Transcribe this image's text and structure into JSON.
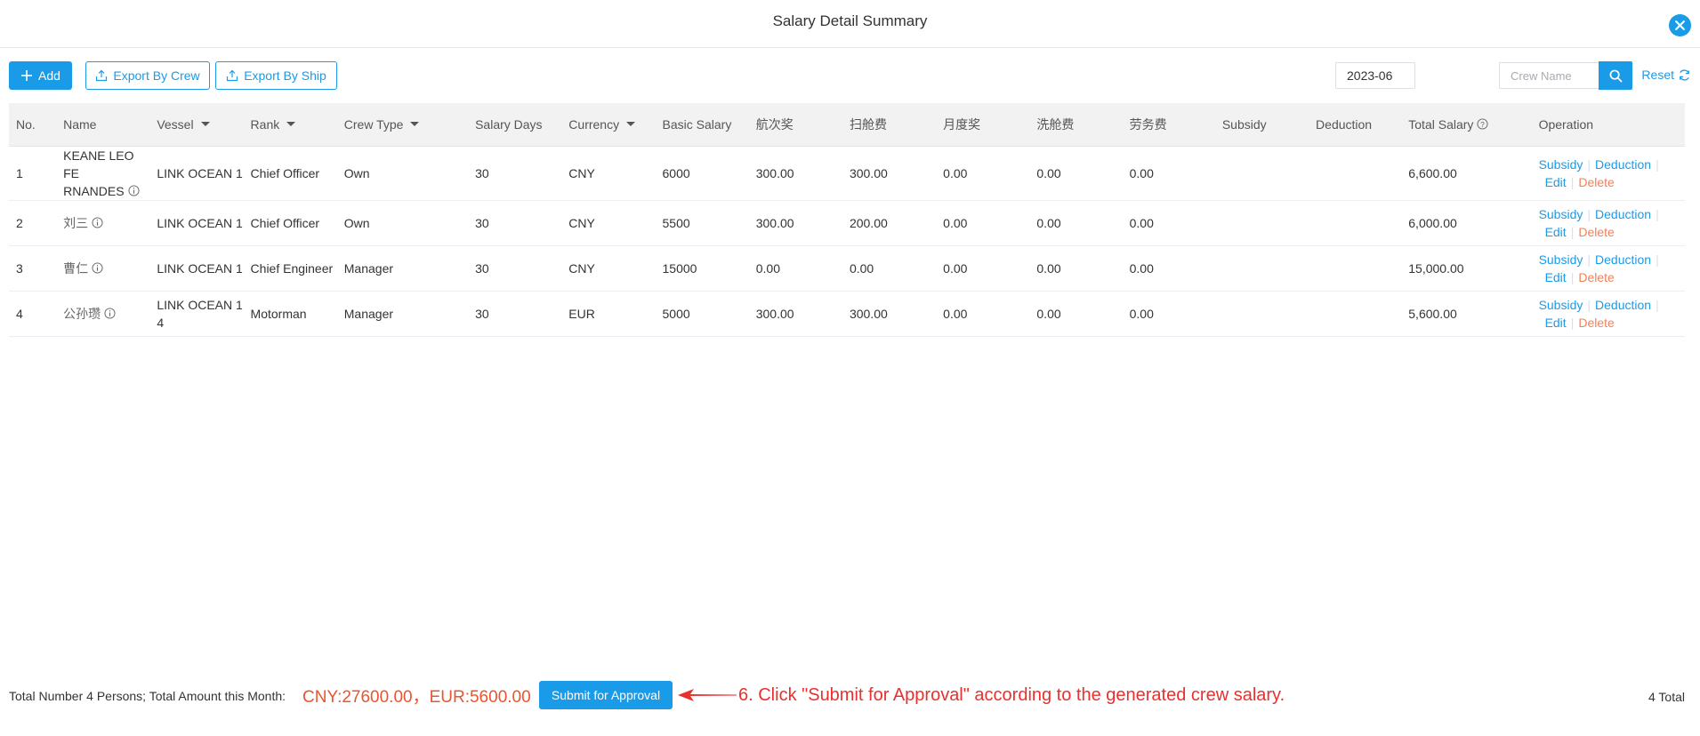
{
  "dialog": {
    "title": "Salary Detail Summary",
    "close_icon": "close-icon"
  },
  "toolbar": {
    "add_label": "Add",
    "export_crew_label": "Export By Crew",
    "export_ship_label": "Export By Ship"
  },
  "search": {
    "month_value": "2023-06",
    "name_placeholder": "Crew Name",
    "reset_label": "Reset"
  },
  "table": {
    "headers": {
      "no": "No.",
      "name": "Name",
      "vessel": "Vessel",
      "rank": "Rank",
      "crew_type": "Crew Type",
      "salary_days": "Salary Days",
      "currency": "Currency",
      "basic_salary": "Basic Salary",
      "voyage_bonus": "航次奖",
      "cabin_fee": "扫舱费",
      "monthly_bonus": "月度奖",
      "wash_fee": "洗舱费",
      "labor_fee": "劳务费",
      "subsidy": "Subsidy",
      "deduction": "Deduction",
      "total_salary": "Total Salary",
      "operation": "Operation"
    },
    "rows": [
      {
        "no": "1",
        "name_line1": "KEANE LEO FE",
        "name_line2": "RNANDES",
        "vessel_line1": "LINK OCEAN 1",
        "vessel_line2": "",
        "rank": "Chief Officer",
        "crew_type": "Own",
        "salary_days": "30",
        "currency": "CNY",
        "basic_salary": "6000",
        "voyage_bonus": "300.00",
        "cabin_fee": "300.00",
        "monthly_bonus": "0.00",
        "wash_fee": "0.00",
        "labor_fee": "0.00",
        "subsidy": "",
        "deduction": "",
        "total_salary": "6,600.00"
      },
      {
        "no": "2",
        "name_line1": "刘三",
        "name_line2": "",
        "vessel_line1": "LINK OCEAN 1",
        "vessel_line2": "",
        "rank": "Chief Officer",
        "crew_type": "Own",
        "salary_days": "30",
        "currency": "CNY",
        "basic_salary": "5500",
        "voyage_bonus": "300.00",
        "cabin_fee": "200.00",
        "monthly_bonus": "0.00",
        "wash_fee": "0.00",
        "labor_fee": "0.00",
        "subsidy": "",
        "deduction": "",
        "total_salary": "6,000.00"
      },
      {
        "no": "3",
        "name_line1": "曹仁",
        "name_line2": "",
        "vessel_line1": "LINK OCEAN 1",
        "vessel_line2": "",
        "rank": "Chief Engineer",
        "crew_type": "Manager",
        "salary_days": "30",
        "currency": "CNY",
        "basic_salary": "15000",
        "voyage_bonus": "0.00",
        "cabin_fee": "0.00",
        "monthly_bonus": "0.00",
        "wash_fee": "0.00",
        "labor_fee": "0.00",
        "subsidy": "",
        "deduction": "",
        "total_salary": "15,000.00"
      },
      {
        "no": "4",
        "name_line1": "公孙瓒",
        "name_line2": "",
        "vessel_line1": "LINK OCEAN 1",
        "vessel_line2": "4",
        "rank": "Motorman",
        "crew_type": "Manager",
        "salary_days": "30",
        "currency": "EUR",
        "basic_salary": "5000",
        "voyage_bonus": "300.00",
        "cabin_fee": "300.00",
        "monthly_bonus": "0.00",
        "wash_fee": "0.00",
        "labor_fee": "0.00",
        "subsidy": "",
        "deduction": "",
        "total_salary": "5,600.00"
      }
    ],
    "ops": {
      "subsidy": "Subsidy",
      "deduction": "Deduction",
      "edit": "Edit",
      "delete": "Delete"
    }
  },
  "footer": {
    "summary_text": "Total Number 4 Persons;  Total Amount this Month:",
    "amount_text": "CNY:27600.00，EUR:5600.00",
    "submit_label": "Submit for Approval",
    "annotation": "6. Click \"Submit for Approval\" according to the generated crew salary.",
    "total_count": "4 Total"
  },
  "colors": {
    "primary": "#1a9be8",
    "delete": "#f0825b",
    "amount": "#e8552e",
    "annotation": "#e8312e"
  }
}
